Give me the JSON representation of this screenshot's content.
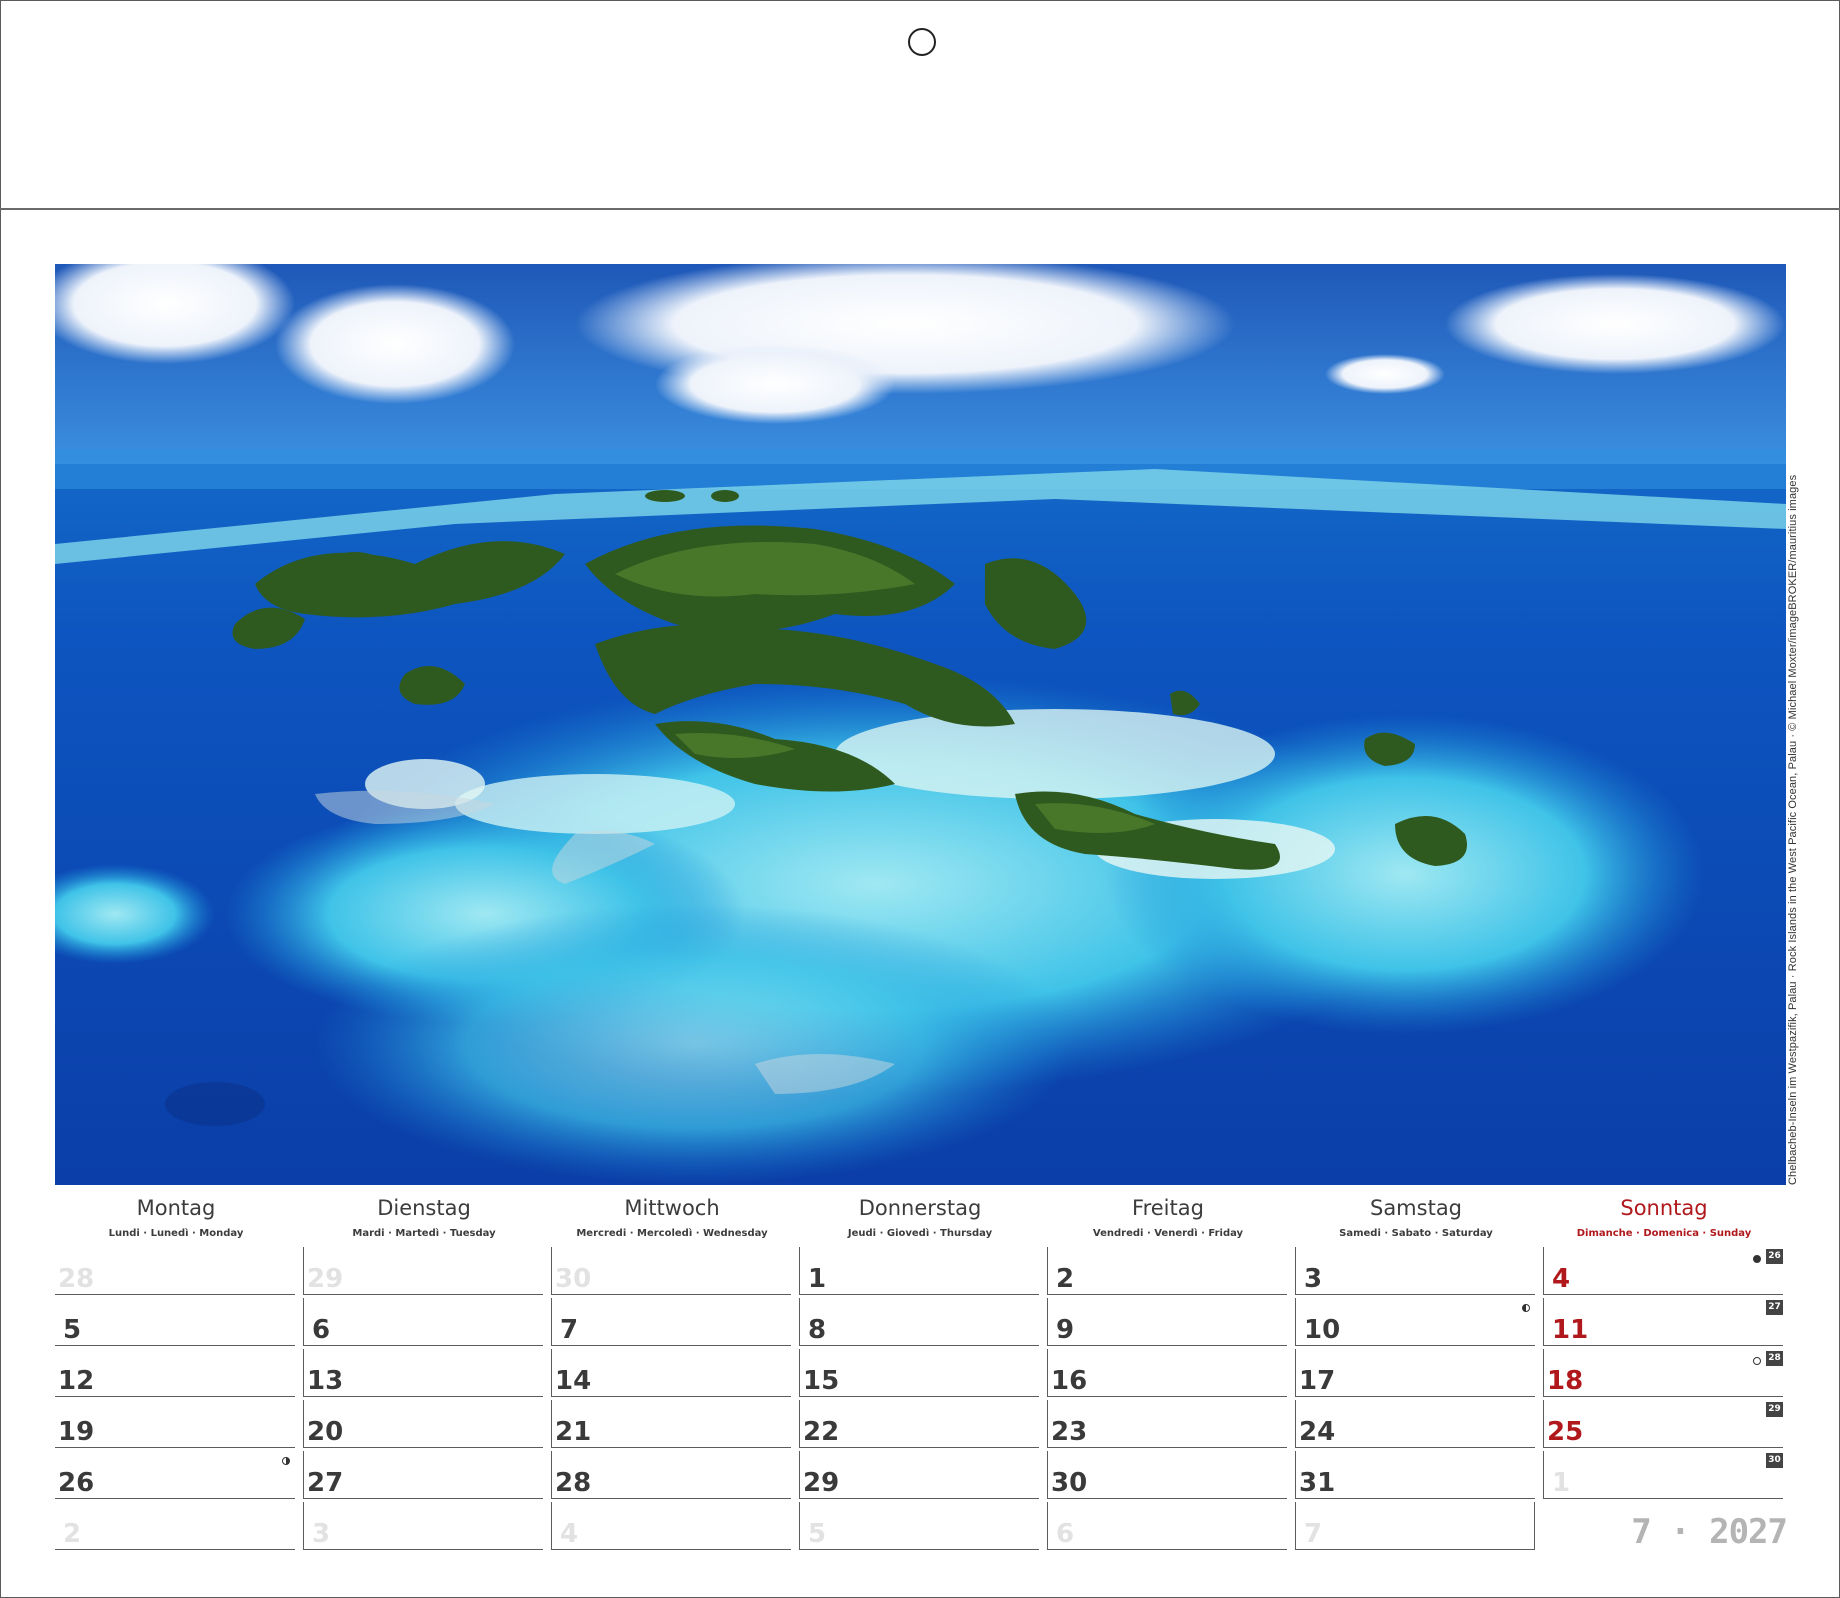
{
  "photo_credit": "Chelbacheb-Inseln im Westpazifik, Palau · Rock Islands in the West Pacific Ocean, Palau · © Michael Moxter/imageBROKER/mauritius images",
  "weekdays": [
    {
      "name": "Montag",
      "sub": "Lundi · Lunedì · Monday"
    },
    {
      "name": "Dienstag",
      "sub": "Mardi · Martedì · Tuesday"
    },
    {
      "name": "Mittwoch",
      "sub": "Mercredi · Mercoledì · Wednesday"
    },
    {
      "name": "Donnerstag",
      "sub": "Jeudi · Giovedì · Thursday"
    },
    {
      "name": "Freitag",
      "sub": "Vendredi · Venerdì · Friday"
    },
    {
      "name": "Samstag",
      "sub": "Samedi · Sabato · Saturday"
    },
    {
      "name": "Sonntag",
      "sub": "Dimanche · Domenica · Sunday"
    }
  ],
  "weeks": [
    {
      "week": "26",
      "days": [
        "28",
        "29",
        "30",
        "1",
        "2",
        "3",
        "4"
      ]
    },
    {
      "week": "27",
      "days": [
        "5",
        "6",
        "7",
        "8",
        "9",
        "10",
        "11"
      ]
    },
    {
      "week": "28",
      "days": [
        "12",
        "13",
        "14",
        "15",
        "16",
        "17",
        "18"
      ]
    },
    {
      "week": "29",
      "days": [
        "19",
        "20",
        "21",
        "22",
        "23",
        "24",
        "25"
      ]
    },
    {
      "week": "30",
      "days": [
        "26",
        "27",
        "28",
        "29",
        "30",
        "31",
        "1"
      ]
    },
    {
      "week": "",
      "days": [
        "2",
        "3",
        "4",
        "5",
        "6",
        "7",
        ""
      ]
    }
  ],
  "moon_phases": [
    {
      "day": "4",
      "phase": "new-moon"
    },
    {
      "day": "10",
      "phase": "first-quarter"
    },
    {
      "day": "18",
      "phase": "full-moon"
    },
    {
      "day": "26",
      "phase": "last-quarter"
    }
  ],
  "month_year": "7 · 2027",
  "colors": {
    "sunday": "#b0181c",
    "text": "#3a3a3a",
    "outside_month": "#e2e2e2",
    "week_badge": "#444444"
  }
}
